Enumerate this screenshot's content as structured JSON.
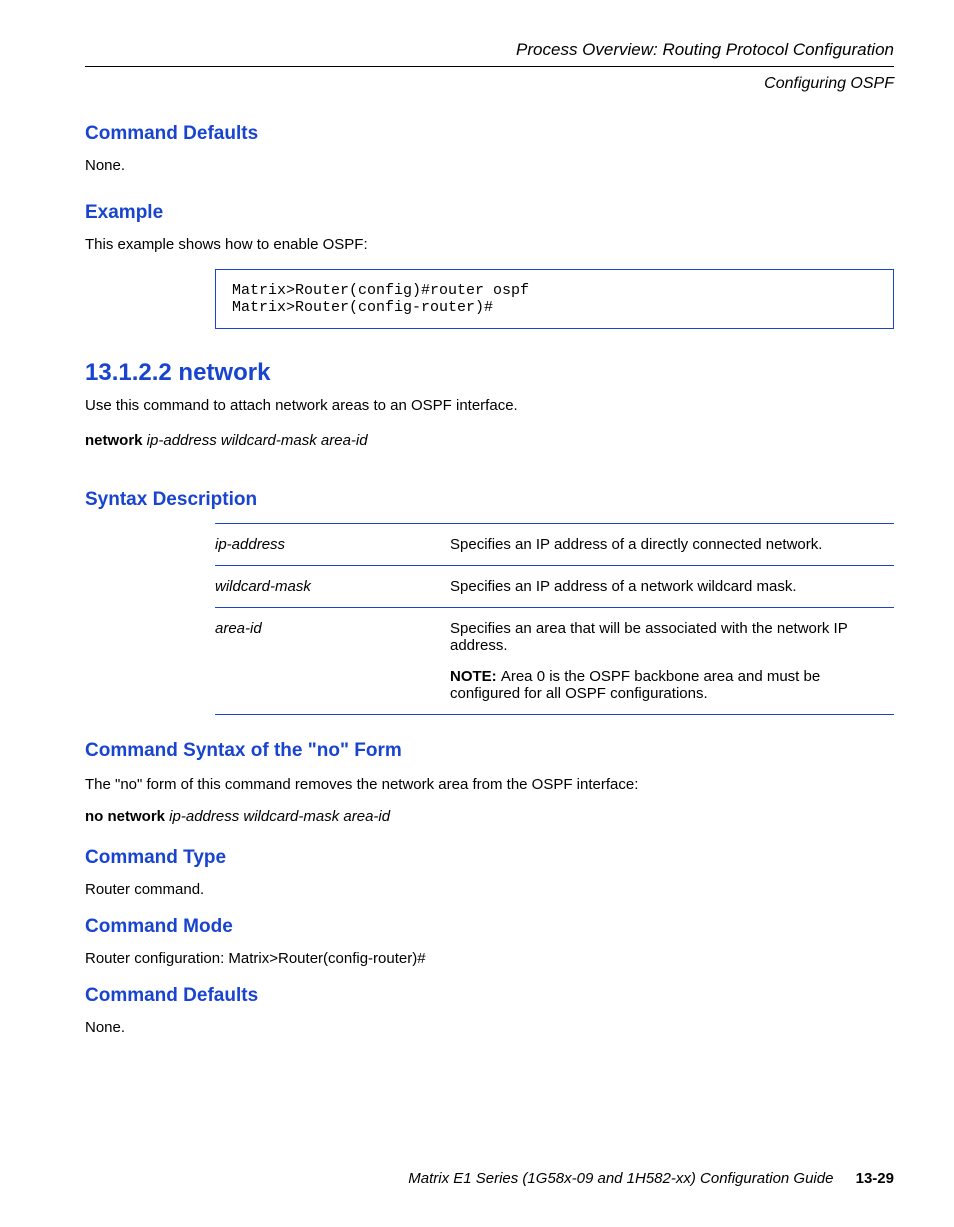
{
  "header": {
    "line1": "Process Overview: Routing Protocol Configuration",
    "line2": "Configuring OSPF"
  },
  "sections": {
    "command_defaults_1": "Command Defaults",
    "command_defaults_1_text": "None.",
    "example": "Example",
    "example_text": "This example shows how to enable OSPF:",
    "code_box": "Matrix>Router(config)#router ospf\nMatrix>Router(config-router)#",
    "network_heading": "13.1.2.2  network",
    "network_text1": "Use this command to attach network areas to an OSPF interface.",
    "network_syntax_cmd": "network",
    "network_syntax_param": " ip-address wildcard-mask area-id",
    "syntax_description": "Syntax Description",
    "syntax_rows": [
      {
        "param": "ip-address",
        "desc": "Specifies an IP address of a directly connected network.",
        "note": null
      },
      {
        "param": "wildcard-mask",
        "desc": "Specifies an IP address of a network wildcard mask.",
        "note": null
      },
      {
        "param": "area-id",
        "desc": "Specifies an area that will be associated with the network IP address.",
        "note_label": "NOTE: ",
        "note_text": "Area 0 is the OSPF backbone area and must be configured for all OSPF configurations."
      }
    ],
    "no_form": "Command Syntax of the \"no\" Form",
    "no_form_text": "The \"no\" form of this command removes the network area from the OSPF interface:",
    "no_form_cmd": "no network",
    "no_form_param": " ip-address wildcard-mask area-id",
    "command_type": "Command Type",
    "command_type_text": "Router command.",
    "command_mode": "Command Mode",
    "command_mode_text": "Router configuration: Matrix>Router(config-router)#",
    "command_defaults_2": "Command Defaults",
    "command_defaults_2_text": "None."
  },
  "footer": {
    "title": "Matrix E1 Series (1G58x-09 and 1H582-xx) Configuration Guide",
    "page": "13-29"
  }
}
